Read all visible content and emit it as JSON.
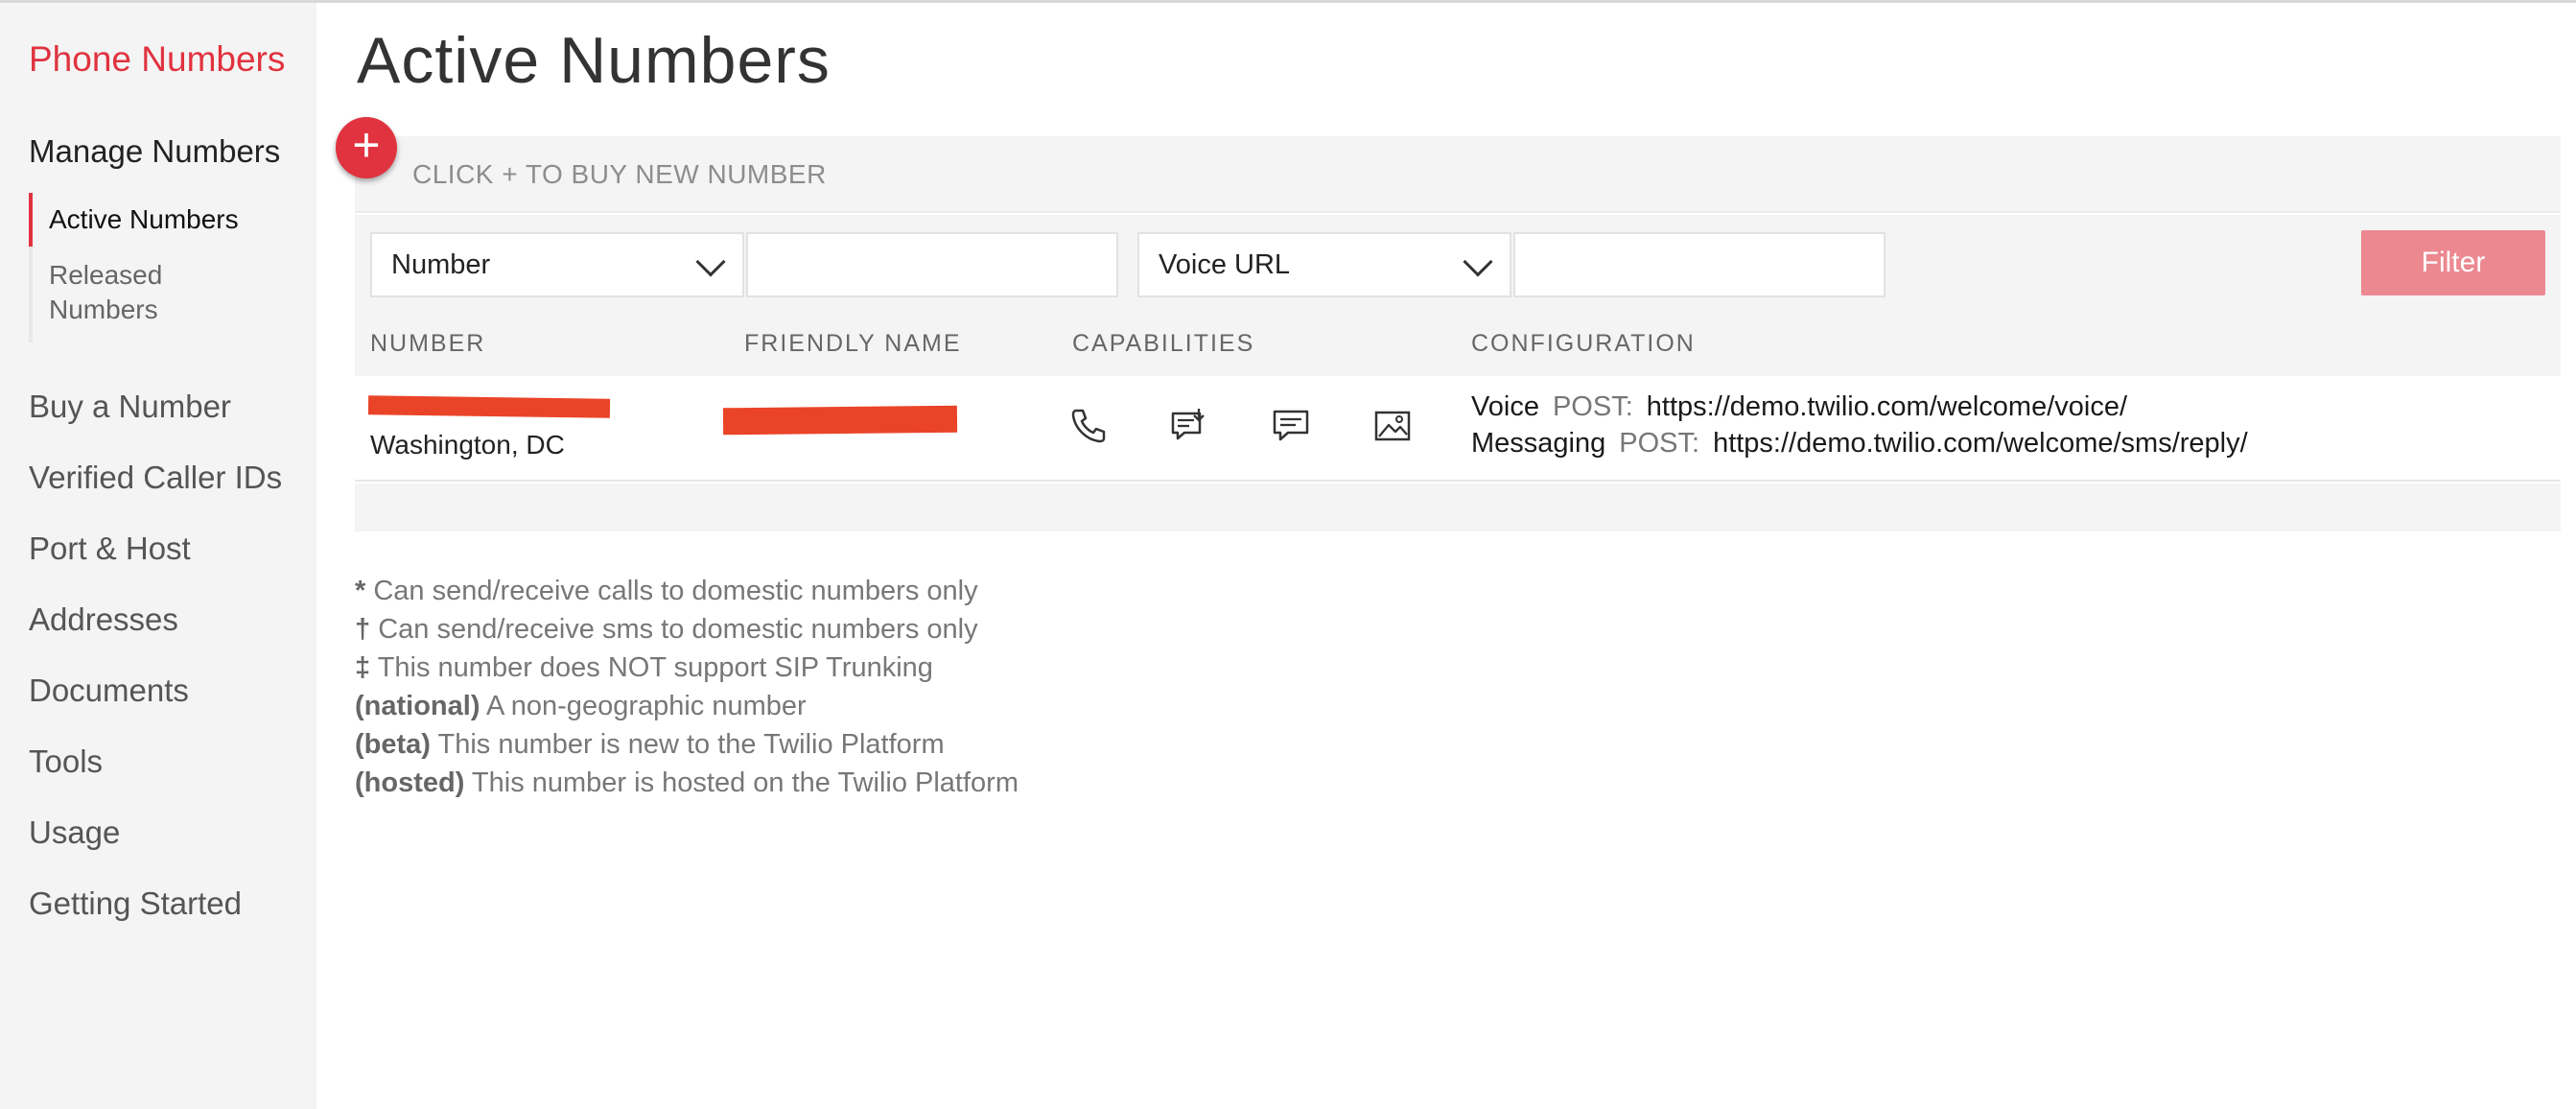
{
  "sidebar": {
    "title": "Phone Numbers",
    "section": "Manage Numbers",
    "sub_items": [
      {
        "label": "Active Numbers"
      },
      {
        "label": "Released Numbers"
      }
    ],
    "items": [
      {
        "label": "Buy a Number"
      },
      {
        "label": "Verified Caller IDs"
      },
      {
        "label": "Port & Host"
      },
      {
        "label": "Addresses"
      },
      {
        "label": "Documents"
      },
      {
        "label": "Tools"
      },
      {
        "label": "Usage"
      },
      {
        "label": "Getting Started"
      }
    ]
  },
  "main": {
    "title": "Active Numbers",
    "buy_prompt": "CLICK + TO BUY NEW NUMBER",
    "add_icon": "+",
    "filters": {
      "field1": "Number",
      "field1_value": "",
      "field2": "Voice URL",
      "field2_value": "",
      "button": "Filter"
    },
    "columns": [
      "NUMBER",
      "FRIENDLY NAME",
      "CAPABILITIES",
      "CONFIGURATION"
    ],
    "rows": [
      {
        "location": "Washington, DC",
        "capabilities": [
          "phone-icon",
          "mms-icon",
          "sms-icon",
          "fax-icon"
        ],
        "configuration": [
          {
            "type": "Voice",
            "method": "POST:",
            "url": "https://demo.twilio.com/welcome/voice/"
          },
          {
            "type": "Messaging",
            "method": "POST:",
            "url": "https://demo.twilio.com/welcome/sms/reply/"
          }
        ]
      }
    ],
    "notes": [
      {
        "mark": "*",
        "text": "Can send/receive calls to domestic numbers only"
      },
      {
        "mark": "†",
        "text": "Can send/receive sms to domestic numbers only"
      },
      {
        "mark": "‡",
        "text": "This number does NOT support SIP Trunking"
      },
      {
        "mark": "(national)",
        "text": "A non-geographic number"
      },
      {
        "mark": "(beta)",
        "text": "This number is new to the Twilio Platform"
      },
      {
        "mark": "(hosted)",
        "text": "This number is hosted on the Twilio Platform"
      }
    ]
  },
  "colors": {
    "accent": "#e0333f",
    "filter_button": "#ec8890",
    "redaction": "#ea4428",
    "sidebar_bg": "#f4f4f4"
  }
}
